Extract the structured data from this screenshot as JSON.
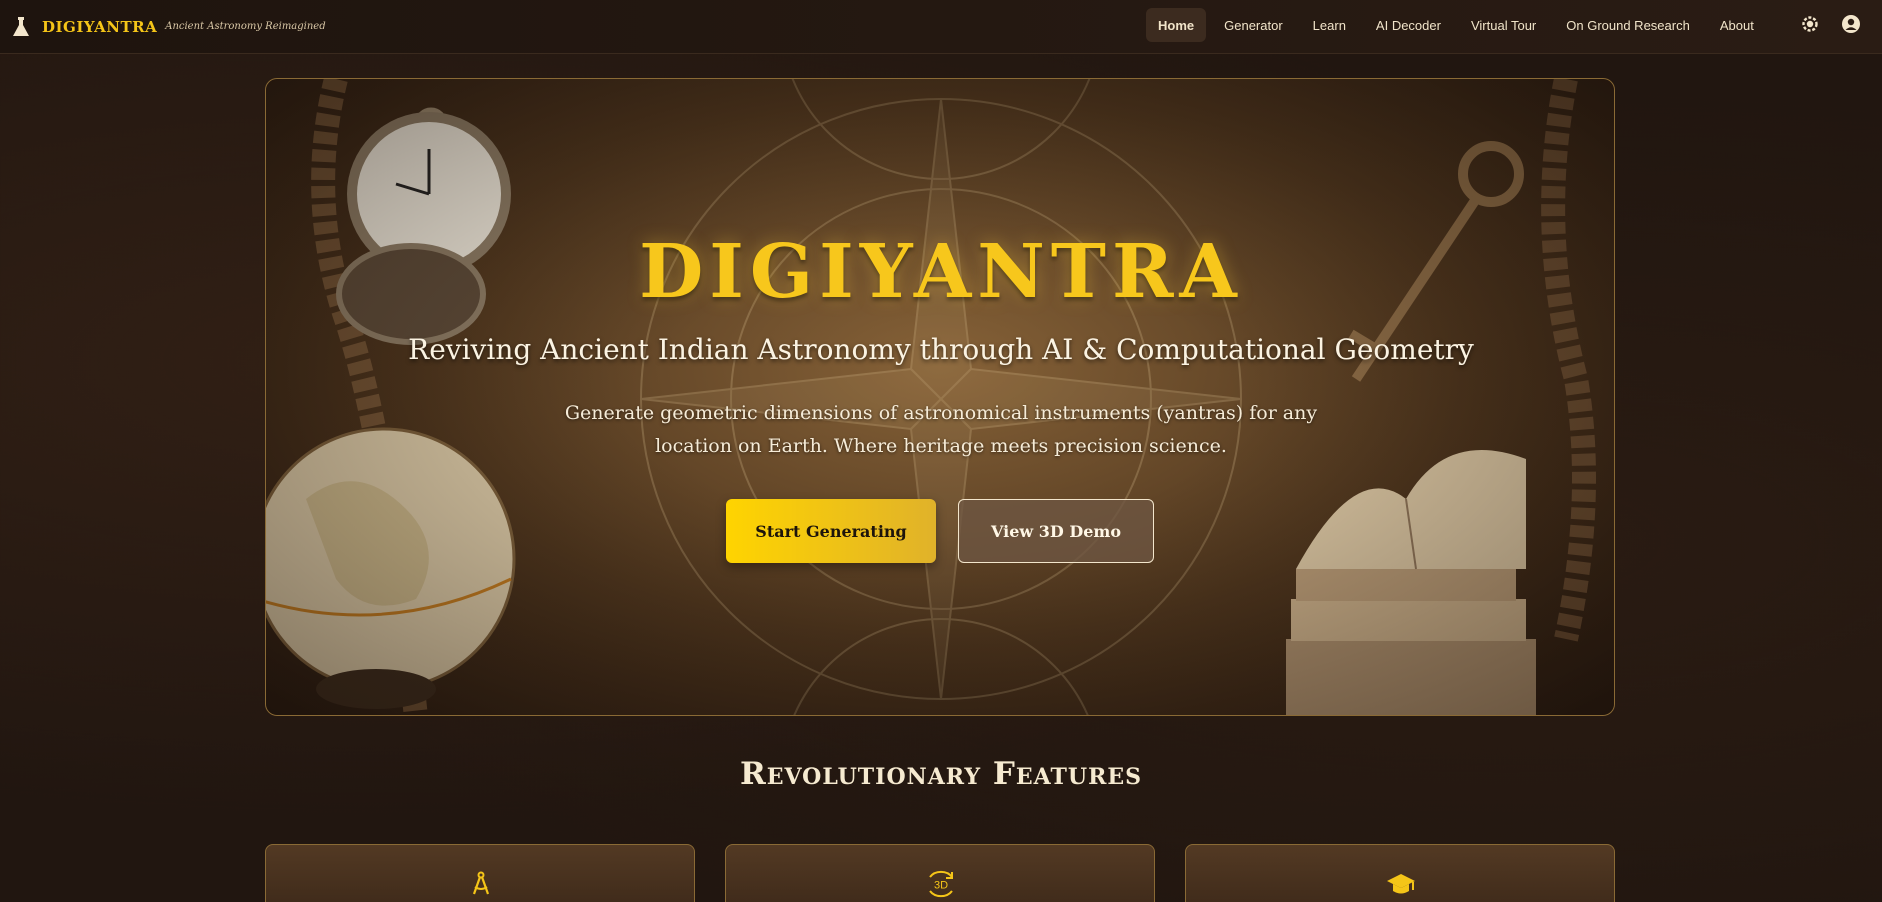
{
  "app": {
    "brand_name": "DIGIYANTRA",
    "tagline": "Ancient Astronomy Reimagined",
    "accent_color": "#f5c518"
  },
  "nav": {
    "items": [
      {
        "label": "Home",
        "active": true
      },
      {
        "label": "Generator",
        "active": false
      },
      {
        "label": "Learn",
        "active": false
      },
      {
        "label": "AI Decoder",
        "active": false
      },
      {
        "label": "Virtual Tour",
        "active": false
      },
      {
        "label": "On Ground Research",
        "active": false
      },
      {
        "label": "About",
        "active": false
      }
    ],
    "icons": [
      "theme-toggle-icon",
      "user-account-icon"
    ]
  },
  "hero": {
    "title": "DIGIYANTRA",
    "subtitle": "Reviving Ancient Indian Astronomy through AI & Computational Geometry",
    "description": "Generate geometric dimensions of astronomical instruments (yantras) for any location on Earth. Where heritage meets precision science.",
    "primary_button": "Start Generating",
    "secondary_button": "View 3D Demo",
    "background_icons": [
      "pocket-watch-icon",
      "globe-icon",
      "antique-key-icon",
      "books-icon",
      "compass-rose-icon"
    ]
  },
  "features": {
    "title": "Revolutionary Features",
    "cards": [
      {
        "icon": "drafting-compass-icon"
      },
      {
        "icon": "rotate-3d-icon",
        "icon_text": "3D"
      },
      {
        "icon": "graduation-cap-icon"
      }
    ]
  }
}
